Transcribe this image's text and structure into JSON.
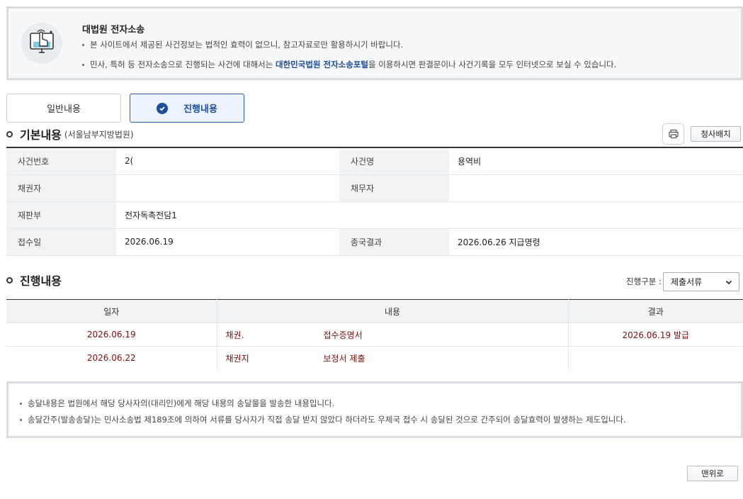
{
  "notice": {
    "title": "대법원 전자소송",
    "line1": "본 사이트에서 제공된 사건정보는 법적인 효력이 없으니, 참고자료로만 활용하시기 바랍니다.",
    "line2_before": "민사, 특허 등 전자소송으로 진행되는 사건에 대해서는 ",
    "line2_link": "대한민국법원 전자소송포털",
    "line2_after": "을 이용하시면 판결문이나 사건기록을 모두 인터넷으로 보실 수 있습니다.",
    "icon": "touch-screen-icon"
  },
  "tabs": {
    "general": "일반내용",
    "progress": "진행내용"
  },
  "basic": {
    "title": "기본내용",
    "court": "(서울남부지방법원)",
    "print_icon": "print-icon",
    "court_location_button": "청사배치",
    "rows": [
      {
        "l1": "사건번호",
        "v1": "2(",
        "l2": "사건명",
        "v2": "용역비"
      },
      {
        "l1": "채권자",
        "v1": "",
        "l2": "채무자",
        "v2": ""
      },
      {
        "l1": "재판부",
        "v1": "전자독촉전담1"
      },
      {
        "l1": "접수일",
        "v1": "2026.06.19",
        "l2": "종국결과",
        "v2": "2026.06.26 지급명령"
      }
    ]
  },
  "progress": {
    "title": "진행내용",
    "filter_label": "진행구분 :",
    "filter_value": "제출서류",
    "columns": [
      "일자",
      "내용",
      "결과"
    ],
    "rows": [
      {
        "date": "2026.06.19",
        "party": "채권.",
        "content": "접수증명서",
        "result": "2026.06.19 발급"
      },
      {
        "date": "2026.06.22",
        "party": "채권지",
        "content": "보정서 제출",
        "result": ""
      }
    ]
  },
  "bottom_notice": {
    "line1": "송달내용은 법원에서 해당 당사자의(대리인)에게 해당 내용의 송달물을 발송한 내용입니다.",
    "line2": "송달간주(발송송달)는 민사소송법 제189조에 의하여 서류를 당사자가 직접 송달 받지 않았다 하더라도 우체국 접수 시 송달된 것으로 간주되어 송달효력이 발생하는 제도입니다."
  },
  "top_button": "맨위로",
  "colors": {
    "accent": "#1c4e9c",
    "progress_text": "#7a1010"
  }
}
